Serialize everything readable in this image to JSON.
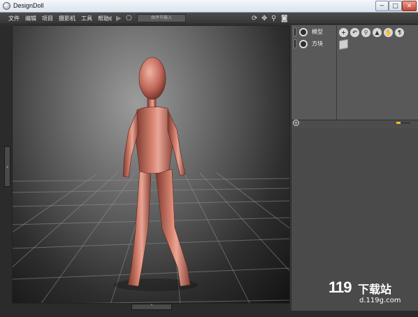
{
  "window": {
    "title": "DesignDoll",
    "min": "─",
    "max": "□",
    "close": "✕"
  },
  "menu": [
    "文件",
    "编辑",
    "项目",
    "摄影机",
    "工具",
    "帮助"
  ],
  "toolbar": {
    "input_placeholder": "由序号输入",
    "icons": [
      "undo-icon",
      "redo-icon",
      "camera-icon",
      "rotate-icon",
      "move-icon",
      "zoom-icon",
      "screenshot-icon"
    ]
  },
  "panel": {
    "items": [
      {
        "label": "模型",
        "icon": "gear-icon"
      },
      {
        "label": "方块",
        "icon": "gear-icon"
      }
    ],
    "tools": [
      "add-icon",
      "undo-pose-icon",
      "search-icon",
      "select-icon",
      "hand-icon",
      "pin-icon",
      "cube-icon"
    ]
  },
  "colors": {
    "accent": "#f4c020",
    "figure": "#c46a5c"
  },
  "watermark": {
    "logo": "119",
    "text": "下载站",
    "url": "d.119g.com"
  }
}
